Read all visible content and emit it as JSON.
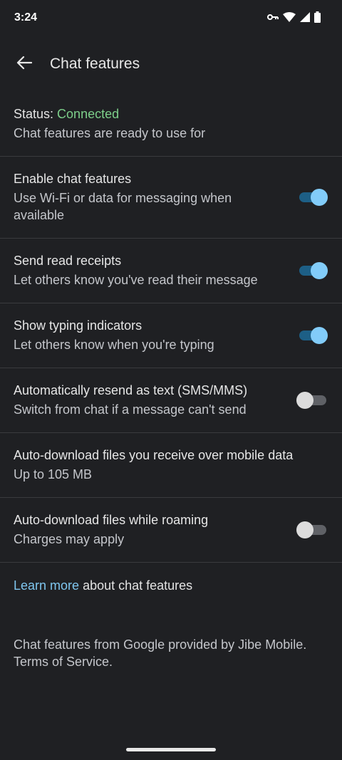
{
  "status_bar": {
    "time": "3:24",
    "icons": [
      "vpn-key-icon",
      "wifi-icon",
      "cell-signal-icon",
      "battery-icon"
    ]
  },
  "app_bar": {
    "back_icon": "arrow-back-icon",
    "title": "Chat features"
  },
  "status": {
    "label": "Status:",
    "value": "Connected",
    "description": "Chat features are ready to use for",
    "value_color": "#7dcf8a"
  },
  "settings": [
    {
      "title": "Enable chat features",
      "subtitle": "Use Wi-Fi or data for messaging when available",
      "toggle": true
    },
    {
      "title": "Send read receipts",
      "subtitle": "Let others know you've read their message",
      "toggle": true
    },
    {
      "title": "Show typing indicators",
      "subtitle": "Let others know when you're typing",
      "toggle": true
    },
    {
      "title": "Automatically resend as text (SMS/MMS)",
      "subtitle": "Switch from chat if a message can't send",
      "toggle": false
    },
    {
      "title": "Auto-download files you receive over mobile data",
      "subtitle": "Up to 105 MB"
    },
    {
      "title": "Auto-download files while roaming",
      "subtitle": "Charges may apply",
      "toggle": false
    }
  ],
  "learn_more": {
    "link": "Learn more",
    "rest": " about chat features"
  },
  "footer": "Chat features from Google provided by Jibe Mobile. Terms of Service.",
  "colors": {
    "background": "#1f2023",
    "accent": "#82ccf9",
    "link": "#7fc6ef"
  }
}
